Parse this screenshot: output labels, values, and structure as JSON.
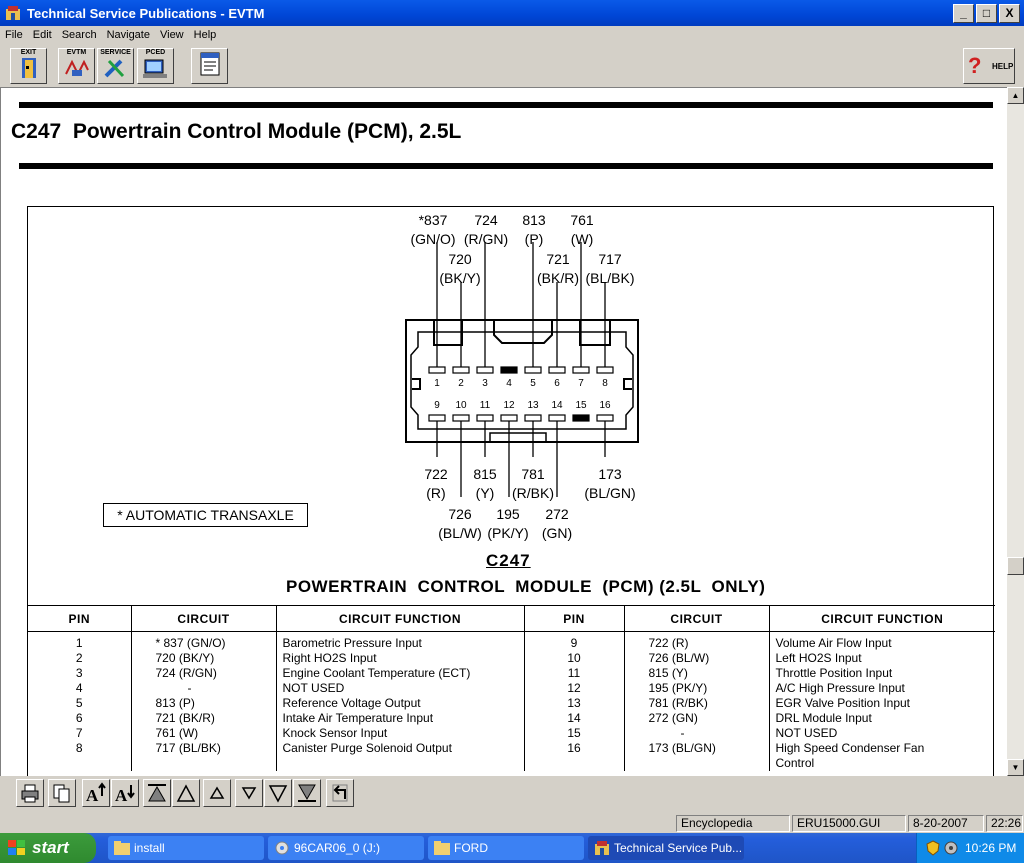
{
  "window": {
    "title": "Technical Service Publications - EVTM",
    "minimize": "_",
    "maximize": "□",
    "close": "X"
  },
  "menu": [
    "File",
    "Edit",
    "Search",
    "Navigate",
    "View",
    "Help"
  ],
  "toolbar": {
    "exit": "EXIT",
    "evtm": "EVTM",
    "service": "SERVICE",
    "pced": "PCED",
    "help": "HELP"
  },
  "document": {
    "heading": "C247  Powertrain Control Module (PCM), 2.5L",
    "top_labels": [
      {
        "num": "*837",
        "color": "(GN/O)"
      },
      {
        "num": "724",
        "color": "(R/GN)"
      },
      {
        "num": "813",
        "color": "(P)"
      },
      {
        "num": "761",
        "color": "(W)"
      },
      {
        "num": "720",
        "color": "(BK/Y)"
      },
      {
        "num": "721",
        "color": "(BK/R)"
      },
      {
        "num": "717",
        "color": "(BL/BK)"
      }
    ],
    "bottom_labels": [
      {
        "num": "722",
        "color": "(R)"
      },
      {
        "num": "815",
        "color": "(Y)"
      },
      {
        "num": "781",
        "color": "(R/BK)"
      },
      {
        "num": "173",
        "color": "(BL/GN)"
      },
      {
        "num": "726",
        "color": "(BL/W)"
      },
      {
        "num": "195",
        "color": "(PK/Y)"
      },
      {
        "num": "272",
        "color": "(GN)"
      }
    ],
    "pin_numbers_top": [
      "1",
      "2",
      "3",
      "4",
      "5",
      "6",
      "7",
      "8"
    ],
    "pin_numbers_bottom": [
      "9",
      "10",
      "11",
      "12",
      "13",
      "14",
      "15",
      "16"
    ],
    "note": "*  AUTOMATIC  TRANSAXLE",
    "caption_id": "C247",
    "caption_title": "POWERTRAIN  CONTROL  MODULE  (PCM) (2.5L  ONLY)",
    "table_headers": [
      "PIN",
      "CIRCUIT",
      "CIRCUIT  FUNCTION",
      "PIN",
      "CIRCUIT",
      "CIRCUIT  FUNCTION"
    ],
    "rows_left": [
      {
        "pin": "1",
        "circuit": "* 837  (GN/O)",
        "function": "Barometric Pressure Input"
      },
      {
        "pin": "2",
        "circuit": "720  (BK/Y)",
        "function": "Right HO2S Input"
      },
      {
        "pin": "3",
        "circuit": "724  (R/GN)",
        "function": "Engine Coolant Temperature (ECT)"
      },
      {
        "pin": "4",
        "circuit": "-",
        "function": "NOT  USED"
      },
      {
        "pin": "5",
        "circuit": "813  (P)",
        "function": "Reference Voltage Output"
      },
      {
        "pin": "6",
        "circuit": "721  (BK/R)",
        "function": "Intake Air Temperature Input"
      },
      {
        "pin": "7",
        "circuit": "761  (W)",
        "function": "Knock Sensor Input"
      },
      {
        "pin": "8",
        "circuit": "717  (BL/BK)",
        "function": "Canister Purge Solenoid Output"
      }
    ],
    "rows_right": [
      {
        "pin": "9",
        "circuit": "722  (R)",
        "function": "Volume Air Flow Input"
      },
      {
        "pin": "10",
        "circuit": "726  (BL/W)",
        "function": "Left HO2S Input"
      },
      {
        "pin": "11",
        "circuit": "815  (Y)",
        "function": "Throttle Position Input"
      },
      {
        "pin": "12",
        "circuit": "195  (PK/Y)",
        "function": "A/C High Pressure Input"
      },
      {
        "pin": "13",
        "circuit": "781  (R/BK)",
        "function": "EGR Valve Position Input"
      },
      {
        "pin": "14",
        "circuit": "272  (GN)",
        "function": "DRL Module Input"
      },
      {
        "pin": "15",
        "circuit": "-",
        "function": "NOT  USED"
      },
      {
        "pin": "16",
        "circuit": "173  (BL/GN)",
        "function": "High Speed Condenser Fan Control"
      }
    ]
  },
  "status": {
    "section": "Encyclopedia",
    "file": "ERU15000.GUI",
    "date": "8-20-2007",
    "time": "22:26"
  },
  "taskbar": {
    "start": "start",
    "tasks": [
      "install",
      "96CAR06_0 (J:)",
      "FORD",
      "Technical Service Pub..."
    ],
    "clock": "10:26 PM"
  }
}
